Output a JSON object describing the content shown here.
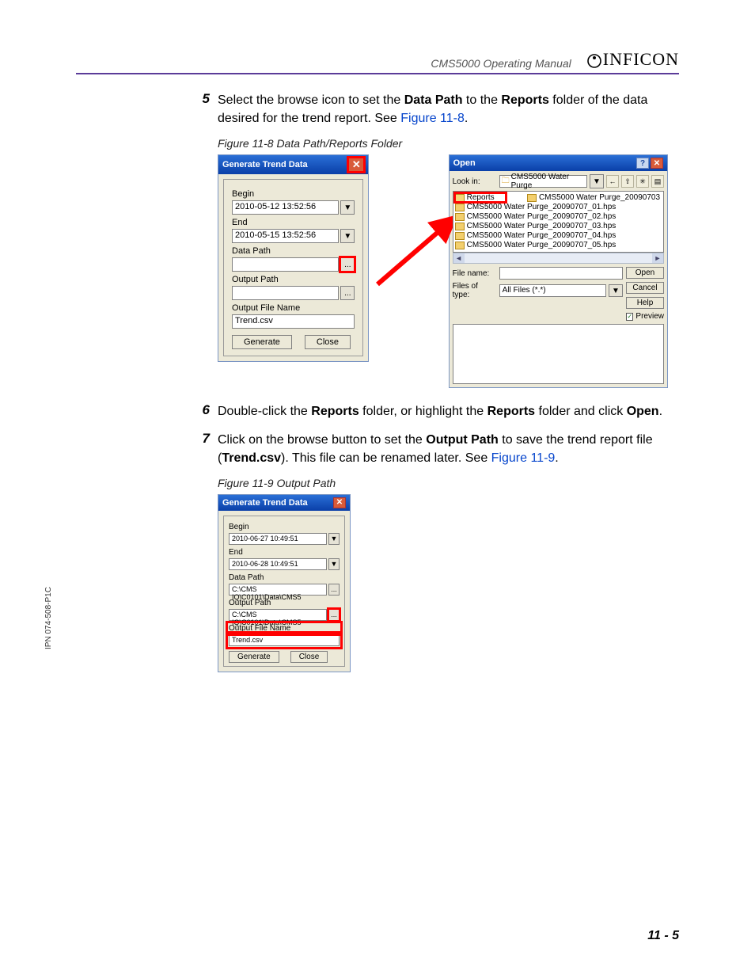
{
  "header": {
    "doc_title": "CMS5000 Operating Manual",
    "brand": "INFICON"
  },
  "side_ipn": "IPN 074-508-P1C",
  "page_number": "11 - 5",
  "steps": {
    "s5": {
      "num": "5",
      "pre": "Select the browse icon to set the ",
      "b1": "Data Path",
      "mid": " to the ",
      "b2": "Reports",
      "post": " folder of the data desired for the trend report. See ",
      "link": "Figure 11-8",
      "end": "."
    },
    "s6": {
      "num": "6",
      "pre": "Double-click the ",
      "b1": "Reports",
      "mid": " folder, or highlight the ",
      "b2": "Reports",
      "post": " folder and click ",
      "b3": "Open",
      "end": "."
    },
    "s7": {
      "num": "7",
      "pre": "Click on the browse button to set the ",
      "b1": "Output Path",
      "mid": " to save the trend report file (",
      "b2": "Trend.csv",
      "post": "). This file can be renamed later. See ",
      "link": "Figure 11-9",
      "end": "."
    }
  },
  "captions": {
    "f8": "Figure 11-8  Data Path/Reports Folder",
    "f9": "Figure 11-9  Output Path"
  },
  "dlg_gt": {
    "title": "Generate Trend Data",
    "begin_lbl": "Begin",
    "begin_val": "2010-05-12    13:52:56",
    "end_lbl": "End",
    "end_val": "2010-05-15    13:52:56",
    "data_path_lbl": "Data Path",
    "output_path_lbl": "Output Path",
    "outfile_lbl": "Output File Name",
    "outfile_val": "Trend.csv",
    "btn_generate": "Generate",
    "btn_close": "Close"
  },
  "dlg_open": {
    "title": "Open",
    "lookin_lbl": "Look in:",
    "lookin_val": "CMS5000 Water Purge",
    "folder": "Reports",
    "extra_item": "CMS5000 Water Purge_20090703",
    "items": [
      "CMS5000 Water Purge_20090707_01.hps",
      "CMS5000 Water Purge_20090707_02.hps",
      "CMS5000 Water Purge_20090707_03.hps",
      "CMS5000 Water Purge_20090707_04.hps",
      "CMS5000 Water Purge_20090707_05.hps"
    ],
    "filename_lbl": "File name:",
    "filetype_lbl": "Files of type:",
    "filetype_val": "All Files (*.*)",
    "btn_open": "Open",
    "btn_cancel": "Cancel",
    "btn_help": "Help",
    "preview_lbl": "Preview"
  },
  "dlg_gt2": {
    "title": "Generate Trend Data",
    "begin_lbl": "Begin",
    "begin_val": "2010-06-27    10:49:51",
    "end_lbl": "End",
    "end_val": "2010-06-28    10:49:51",
    "data_path_lbl": "Data Path",
    "data_path_val": "C:\\CMS IQ\\C0101\\Data\\CMS5",
    "output_path_lbl": "Output Path",
    "output_path_val": "C:\\CMS IQ\\C0101\\Data\\CMS5",
    "outfile_lbl": "Output File Name",
    "outfile_val": "Trend.csv",
    "btn_generate": "Generate",
    "btn_close": "Close"
  }
}
